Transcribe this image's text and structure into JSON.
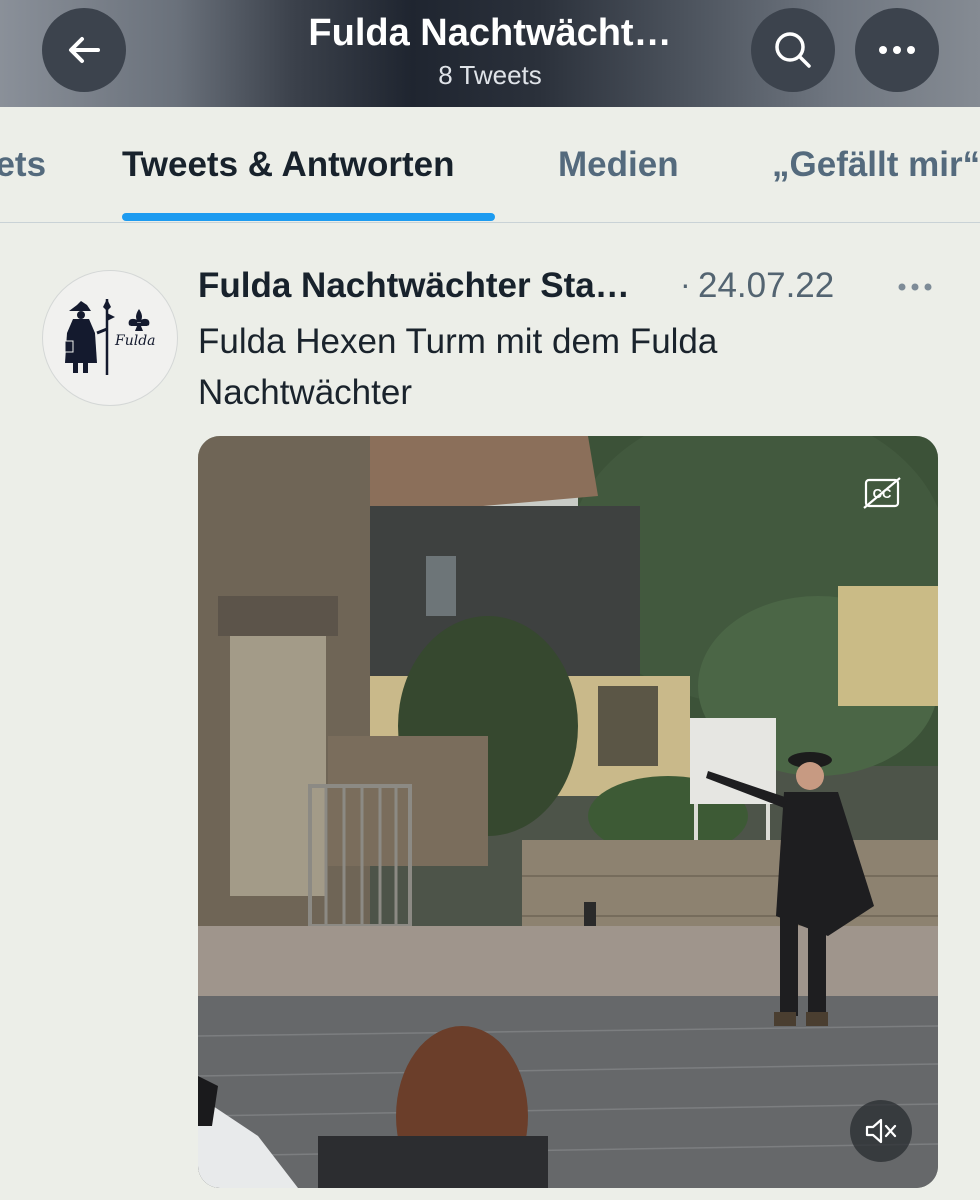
{
  "header": {
    "title": "Fulda Nachtwächt…",
    "subtitle": "8 Tweets"
  },
  "tabs": [
    {
      "label": "Tweets"
    },
    {
      "label": "Tweets & Antworten"
    },
    {
      "label": "Medien"
    },
    {
      "label": "„Gefällt mir“"
    }
  ],
  "tweet": {
    "author_name": "Fulda Nachtwächter Sta…",
    "separator": "·",
    "date": "24.07.22",
    "text": "Fulda Hexen Turm mit dem Fulda Nachtwächter",
    "avatar_text": "Fulda"
  },
  "icons": {
    "back": "arrow-left-icon",
    "search": "search-icon",
    "more": "more-horizontal-icon",
    "captions": "closed-captions-icon",
    "mute": "volume-muted-icon"
  },
  "colors": {
    "accent": "#1d9bf0",
    "background": "#eceee8",
    "muted_text": "#536471"
  }
}
